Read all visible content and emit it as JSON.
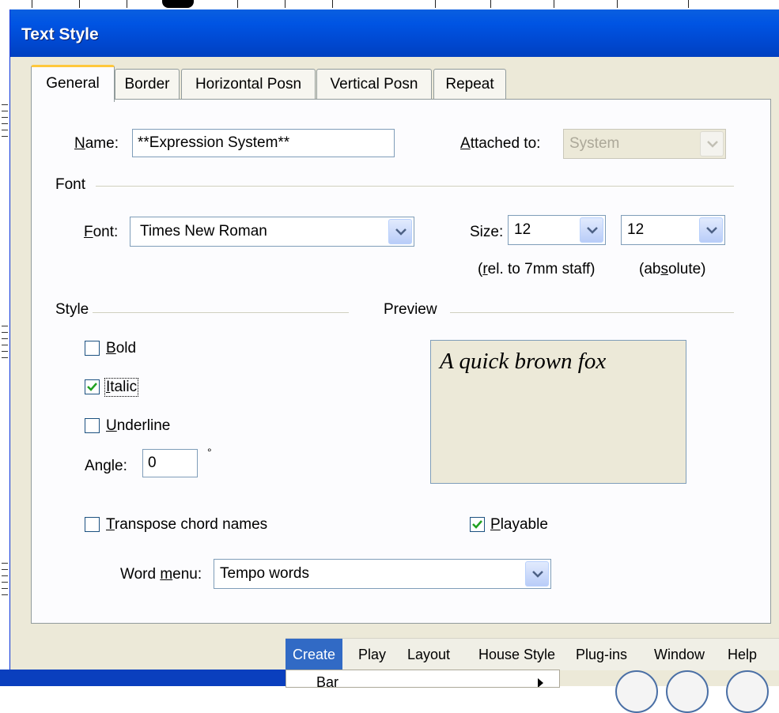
{
  "dialog": {
    "title": "Text Style",
    "tabs": [
      {
        "label": "General",
        "active": true
      },
      {
        "label": "Border"
      },
      {
        "label": "Horizontal Posn"
      },
      {
        "label": "Vertical Posn"
      },
      {
        "label": "Repeat"
      }
    ],
    "name": {
      "label_accel": "N",
      "label_rest": "ame:",
      "value": "**Expression System**"
    },
    "attached": {
      "label_accel": "A",
      "label_rest": "ttached to:",
      "value": "System",
      "enabled": false
    },
    "font_group": {
      "title": "Font"
    },
    "font": {
      "label_accel": "F",
      "label_rest": "ont:",
      "value": "Times New Roman"
    },
    "size": {
      "label": "Size:",
      "relative_value": "12",
      "absolute_value": "12",
      "rel_note_pre": "",
      "rel_note_accel": "r",
      "rel_note_post": "el. to 7mm staff)",
      "rel_note_open": "(",
      "abs_note_pre": "(ab",
      "abs_note_accel": "s",
      "abs_note_post": "olute)"
    },
    "style_group": {
      "title": "Style"
    },
    "preview_group": {
      "title": "Preview",
      "sample": "A quick brown fox"
    },
    "bold": {
      "accel": "B",
      "rest": "old",
      "checked": false
    },
    "italic": {
      "accel": "I",
      "rest": "talic",
      "checked": true
    },
    "underline": {
      "accel": "U",
      "rest": "nderline",
      "checked": false
    },
    "angle": {
      "label": "Angle:",
      "value": "0",
      "unit": "°"
    },
    "transpose": {
      "accel": "T",
      "rest": "ranspose chord names",
      "checked": false
    },
    "playable": {
      "accel": "P",
      "rest": "layable",
      "checked": true
    },
    "word_menu": {
      "label_pre": "Word ",
      "label_accel": "m",
      "label_post": "enu:",
      "value": "Tempo words"
    }
  },
  "menubar": {
    "items": [
      "Create",
      "Play",
      "Layout",
      "House Style",
      "Plug-ins",
      "Window",
      "Help"
    ],
    "open_item": "Create",
    "dropdown_first": "Bar"
  },
  "colors": {
    "titlebar": "#0054e3",
    "dialog_bg": "#ece9d8",
    "menu_highlight": "#316ac5",
    "check": "#21a121"
  }
}
